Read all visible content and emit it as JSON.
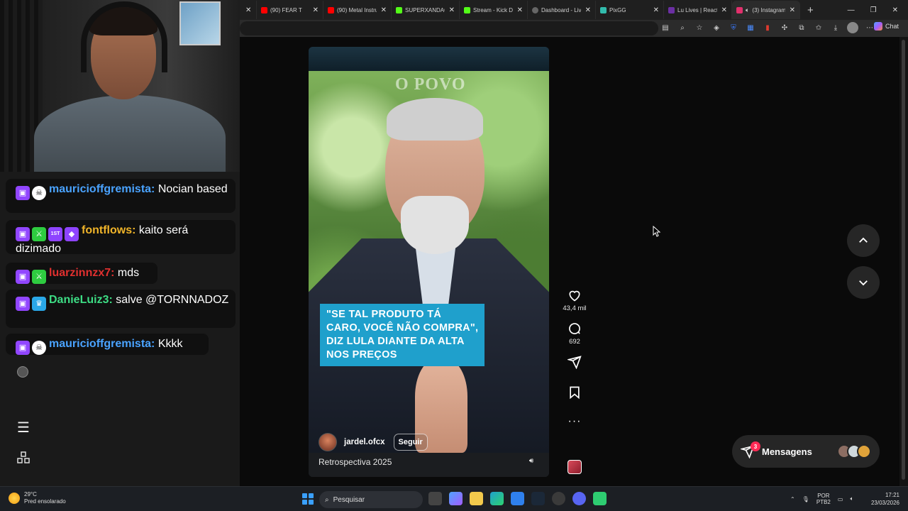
{
  "browser": {
    "tabs": [
      {
        "title": "",
        "favicon_color": "#ff0000",
        "active": false
      },
      {
        "title": "(90) FEAR T",
        "favicon_color": "#ff0000",
        "active": false
      },
      {
        "title": "(90) Metal Instru",
        "favicon_color": "#ff0000",
        "active": false
      },
      {
        "title": "SUPERXANDAO",
        "favicon_color": "#53fc18",
        "active": false
      },
      {
        "title": "Stream - Kick Da",
        "favicon_color": "#53fc18",
        "active": false
      },
      {
        "title": "Dashboard - Liv",
        "favicon_color": "#666666",
        "active": false
      },
      {
        "title": "PixGG",
        "favicon_color": "#32bcad",
        "active": false
      },
      {
        "title": "Lu Lives | React",
        "favicon_color": "#6b2fa3",
        "active": false
      },
      {
        "title": "(3) Instagram",
        "favicon_color": "#e1306c",
        "active": true
      }
    ],
    "chat_button": "Chat"
  },
  "reel": {
    "brand_mark": "O POVO",
    "quote_lines": [
      "\"SE TAL PRODUTO TÁ",
      "CARO, VOCÊ NÃO COMPRA\",",
      "DIZ LULA DIANTE DA ALTA",
      "NOS PREÇOS"
    ],
    "author": "jardel.ofcx",
    "follow_label": "Seguir",
    "caption": "Retrospectiva 2025"
  },
  "actions": {
    "likes": "43,4 mil",
    "comments": "692"
  },
  "messages": {
    "label": "Mensagens",
    "badge": "3"
  },
  "chat": {
    "messages": [
      {
        "user": "mauricioffgremista:",
        "text": " Nocian based",
        "color": "#4aa3ff",
        "badges": [
          "tw",
          "sk"
        ]
      },
      {
        "user": "fontflows:",
        "text": " kaito será dizimado",
        "color": "#f0b429",
        "badges": [
          "tw",
          "gr",
          "pu",
          "pu"
        ]
      },
      {
        "user": "luarzinnzx7:",
        "text": " mds",
        "color": "#e0302f",
        "badges": [
          "tw",
          "gr"
        ]
      },
      {
        "user": "DanieLuiz3:",
        "text": " salve @TORNNADOZ",
        "color": "#3ddc84",
        "badges": [
          "tw",
          "bl"
        ]
      },
      {
        "user": "mauricioffgremista:",
        "text": " Kkkk",
        "color": "#4aa3ff",
        "badges": [
          "tw",
          "sk"
        ]
      }
    ],
    "badge_text": {
      "first": "1ST"
    }
  },
  "taskbar": {
    "weather_temp": "29°C",
    "weather_desc": "Pred ensolarado",
    "search_placeholder": "Pesquisar",
    "lang_top": "POR",
    "lang_bottom": "PTB2",
    "time": "17:21",
    "date": "23/03/2026"
  }
}
